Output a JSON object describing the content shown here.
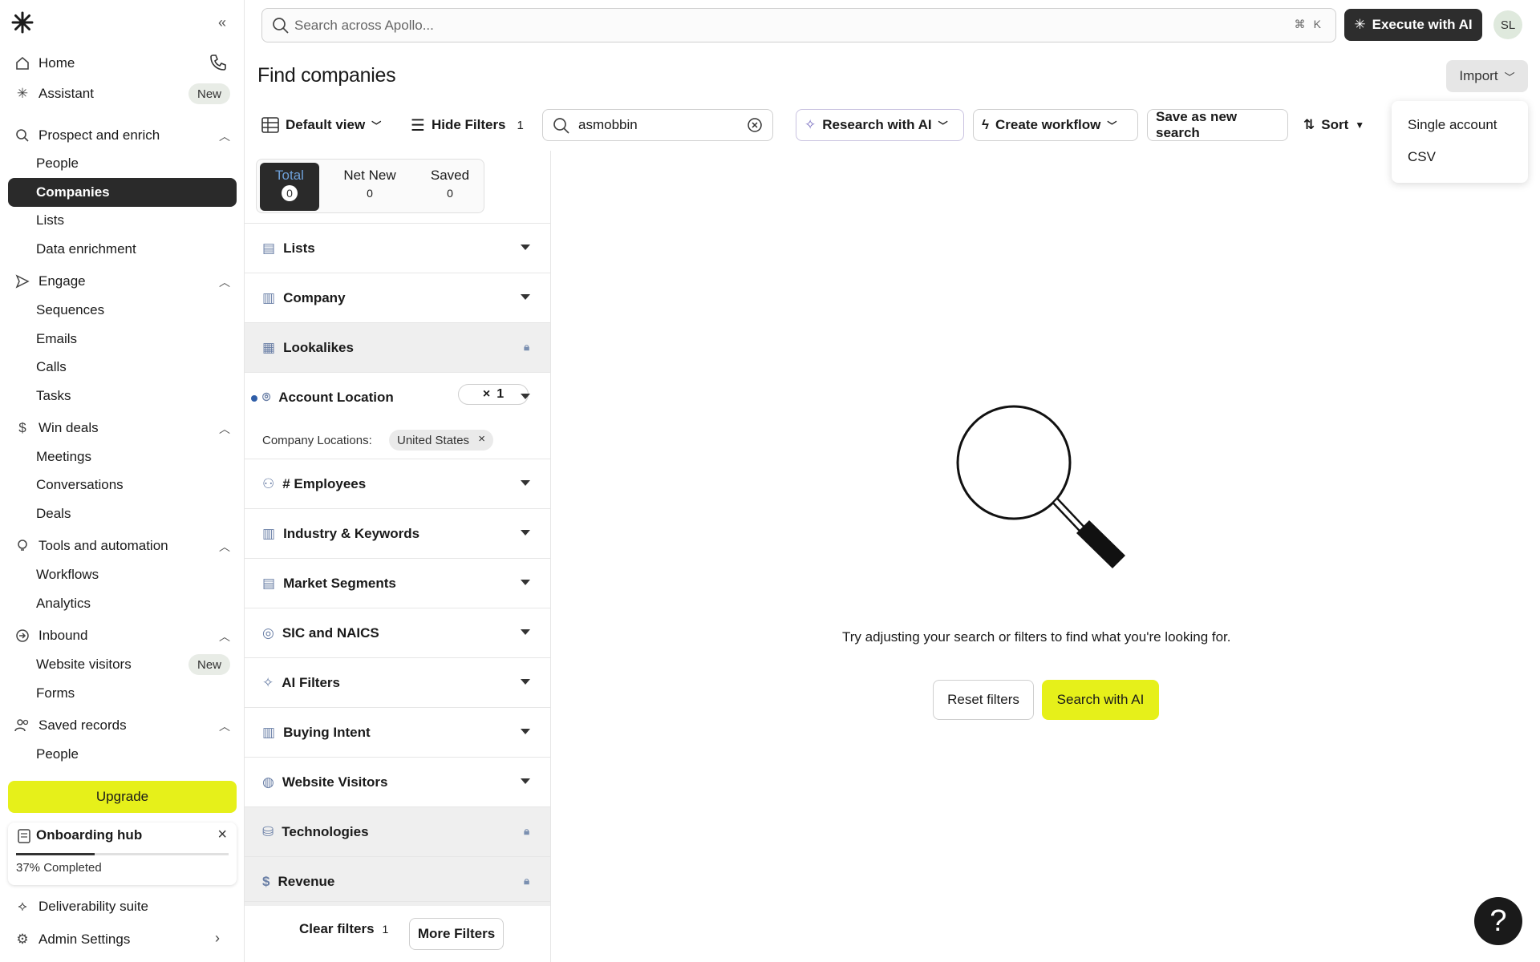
{
  "sidebar": {
    "home": "Home",
    "assistant": "Assistant",
    "new_badge": "New",
    "prospect": "Prospect and enrich",
    "people": "People",
    "companies": "Companies",
    "lists": "Lists",
    "data_enrichment": "Data enrichment",
    "engage": "Engage",
    "sequences": "Sequences",
    "emails": "Emails",
    "calls": "Calls",
    "tasks": "Tasks",
    "win_deals": "Win deals",
    "meetings": "Meetings",
    "conversations": "Conversations",
    "deals": "Deals",
    "tools": "Tools and automation",
    "workflows": "Workflows",
    "analytics": "Analytics",
    "inbound": "Inbound",
    "website_visitors": "Website visitors",
    "forms": "Forms",
    "saved_records": "Saved records",
    "saved_people": "People",
    "upgrade": "Upgrade",
    "onboarding": "Onboarding hub",
    "onboarding_progress": 0.37,
    "onboarding_pct": "37% Completed",
    "deliverability": "Deliverability suite",
    "admin": "Admin Settings"
  },
  "topbar": {
    "search_placeholder": "Search across Apollo...",
    "kbd_cmd": "⌘",
    "kbd_k": "K",
    "execute": "Execute with AI",
    "avatar": "SL"
  },
  "page": {
    "title": "Find companies",
    "import": "Import",
    "import_options": [
      "Single account",
      "CSV"
    ]
  },
  "toolbar": {
    "default_view": "Default view",
    "hide_filters": "Hide Filters",
    "filter_count": "1",
    "search_value": "asmobbin",
    "research_ai": "Research with AI",
    "create_workflow": "Create workflow",
    "save_search": "Save as new search",
    "sort": "Sort"
  },
  "segments": {
    "total": "Total",
    "total_count": "0",
    "net_new": "Net New",
    "net_new_count": "0",
    "saved": "Saved",
    "saved_count": "0"
  },
  "filters": {
    "lists": "Lists",
    "company": "Company",
    "lookalikes": "Lookalikes",
    "account_location": "Account Location",
    "location_count": "1",
    "company_locations": "Company Locations:",
    "location_chip": "United States",
    "employees": "# Employees",
    "industry": "Industry & Keywords",
    "market": "Market Segments",
    "sic": "SIC and NAICS",
    "ai_filters": "AI Filters",
    "buying_intent": "Buying Intent",
    "website_visitors": "Website Visitors",
    "technologies": "Technologies",
    "revenue": "Revenue",
    "clear": "Clear filters",
    "clear_count": "1",
    "more": "More Filters"
  },
  "empty": {
    "message": "Try adjusting your search or filters to find what you're looking for.",
    "reset": "Reset filters",
    "search_ai": "Search with AI"
  },
  "help": "?"
}
